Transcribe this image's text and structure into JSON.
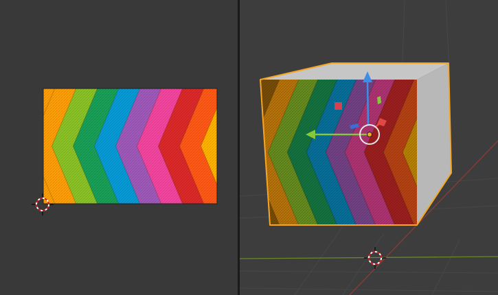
{
  "colors": {
    "uv_background": "#393939",
    "viewport_background": "#3d3d3d",
    "splitter": "#1a1a1a",
    "selection_outline": "#f5a623",
    "x_axis": "#8c3a3a",
    "y_axis": "#6a8a2a",
    "grid": "#474747",
    "gizmo_x": "#86c83c",
    "gizmo_z": "#3d8ee6",
    "gizmo_y": "#e04848",
    "cube_side": "#b8b8b8",
    "cube_top": "#c6c6c6"
  },
  "texture_stripes": [
    "#ff9f0a",
    "#8cc328",
    "#1aa058",
    "#089bd8",
    "#a05aba",
    "#f4469f",
    "#dc2a2a",
    "#ff5a18",
    "#ffb400"
  ],
  "icons": {
    "uv_cursor": "3d-cursor-icon",
    "viewport_cursor": "3d-cursor-icon",
    "origin": "object-origin-icon",
    "gizmo": "move-gizmo-icon"
  }
}
